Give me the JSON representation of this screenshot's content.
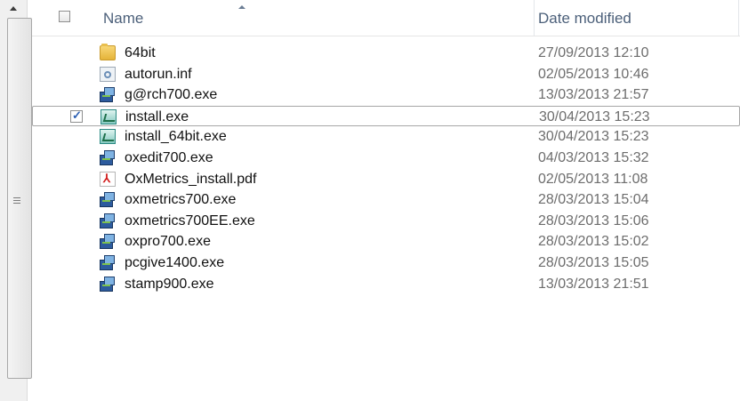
{
  "header": {
    "name_label": "Name",
    "date_label": "Date modified"
  },
  "files": [
    {
      "name": "64bit",
      "date": "27/09/2013 12:10",
      "icon": "folder-icon"
    },
    {
      "name": "autorun.inf",
      "date": "02/05/2013 10:46",
      "icon": "settings-file-icon"
    },
    {
      "name": "g@rch700.exe",
      "date": "13/03/2013 21:57",
      "icon": "installer-icon"
    },
    {
      "name": "install.exe",
      "date": "30/04/2013 15:23",
      "icon": "app-icon",
      "selected": true
    },
    {
      "name": "install_64bit.exe",
      "date": "30/04/2013 15:23",
      "icon": "app-icon"
    },
    {
      "name": "oxedit700.exe",
      "date": "04/03/2013 15:32",
      "icon": "installer-icon"
    },
    {
      "name": "OxMetrics_install.pdf",
      "date": "02/05/2013 11:08",
      "icon": "pdf-icon"
    },
    {
      "name": "oxmetrics700.exe",
      "date": "28/03/2013 15:04",
      "icon": "installer-icon"
    },
    {
      "name": "oxmetrics700EE.exe",
      "date": "28/03/2013 15:06",
      "icon": "installer-icon"
    },
    {
      "name": "oxpro700.exe",
      "date": "28/03/2013 15:02",
      "icon": "installer-icon"
    },
    {
      "name": "pcgive1400.exe",
      "date": "28/03/2013 15:05",
      "icon": "installer-icon"
    },
    {
      "name": "stamp900.exe",
      "date": "13/03/2013 21:51",
      "icon": "installer-icon"
    }
  ],
  "colors": {
    "header_text": "#4c607a",
    "date_text": "#6d6d6d",
    "checkbox_accent": "#2b5fb3"
  }
}
